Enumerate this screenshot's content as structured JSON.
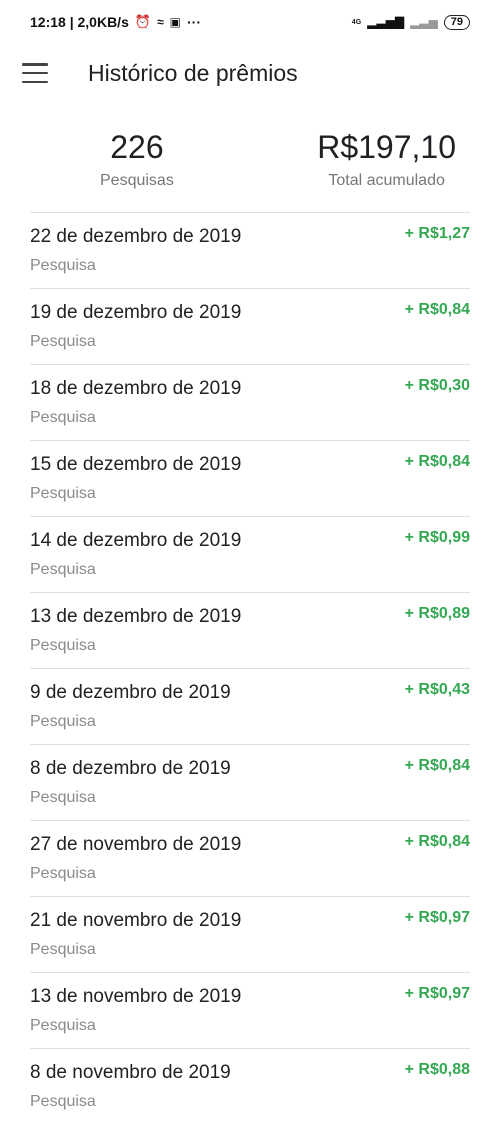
{
  "status_bar": {
    "time_speed": "12:18 | 2,0KB/s",
    "signal_text": "4G",
    "battery": "79"
  },
  "header": {
    "title": "Histórico de prêmios"
  },
  "summary": {
    "count_value": "226",
    "count_label": "Pesquisas",
    "total_value": "R$197,10",
    "total_label": "Total acumulado"
  },
  "rewards": [
    {
      "date": "22 de dezembro de 2019",
      "type": "Pesquisa",
      "amount": "+ R$1,27"
    },
    {
      "date": "19 de dezembro de 2019",
      "type": "Pesquisa",
      "amount": "+ R$0,84"
    },
    {
      "date": "18 de dezembro de 2019",
      "type": "Pesquisa",
      "amount": "+ R$0,30"
    },
    {
      "date": "15 de dezembro de 2019",
      "type": "Pesquisa",
      "amount": "+ R$0,84"
    },
    {
      "date": "14 de dezembro de 2019",
      "type": "Pesquisa",
      "amount": "+ R$0,99"
    },
    {
      "date": "13 de dezembro de 2019",
      "type": "Pesquisa",
      "amount": "+ R$0,89"
    },
    {
      "date": "9 de dezembro de 2019",
      "type": "Pesquisa",
      "amount": "+ R$0,43"
    },
    {
      "date": "8 de dezembro de 2019",
      "type": "Pesquisa",
      "amount": "+ R$0,84"
    },
    {
      "date": "27 de novembro de 2019",
      "type": "Pesquisa",
      "amount": "+ R$0,84"
    },
    {
      "date": "21 de novembro de 2019",
      "type": "Pesquisa",
      "amount": "+ R$0,97"
    },
    {
      "date": "13 de novembro de 2019",
      "type": "Pesquisa",
      "amount": "+ R$0,97"
    },
    {
      "date": "8 de novembro de 2019",
      "type": "Pesquisa",
      "amount": "+ R$0,88"
    }
  ],
  "colors": {
    "amount_green": "#34a853"
  }
}
